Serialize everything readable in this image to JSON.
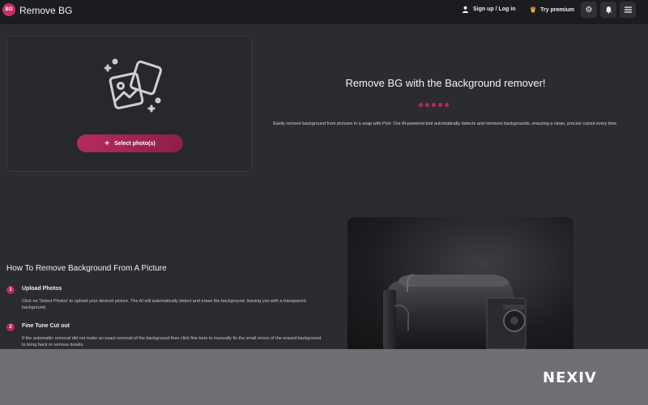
{
  "app": {
    "title": "Remove BG",
    "logo_text": "BG"
  },
  "topbar": {
    "signup_label": "Sign up / Log in",
    "premium_label": "Try premium",
    "icons": [
      "user-icon",
      "crown-icon",
      "gear-icon",
      "bell-icon",
      "menu-icon"
    ]
  },
  "upload": {
    "button_label": "Select photo(s)"
  },
  "hero": {
    "title": "Remove BG with the Background remover!",
    "description": "Easily remove background from pictures in a snap with Pixlr. Our AI-powered tool automatically detects and removes backgrounds, ensuring a clean, precise cutout every time."
  },
  "howto": {
    "title": "How To Remove Background From A Picture",
    "steps": [
      {
        "num": "1",
        "title": "Upload Photos",
        "text": "Click on 'Select Photos' to upload your desired picture. The AI will automatically detect and erase the background, leaving you with a transparent background."
      },
      {
        "num": "2",
        "title": "Fine Tune Cut out",
        "text": "If the automattic removal did not make an exact removal of the background then click fine tune to manually fix the small errors of the erased background to bring back or remove details."
      }
    ]
  },
  "banner": {
    "brand": "NEXIV"
  },
  "colors": {
    "accent": "#b8285f",
    "background": "#2a2c30",
    "topbar": "#1b1c1f",
    "banner": "#6e7073"
  }
}
